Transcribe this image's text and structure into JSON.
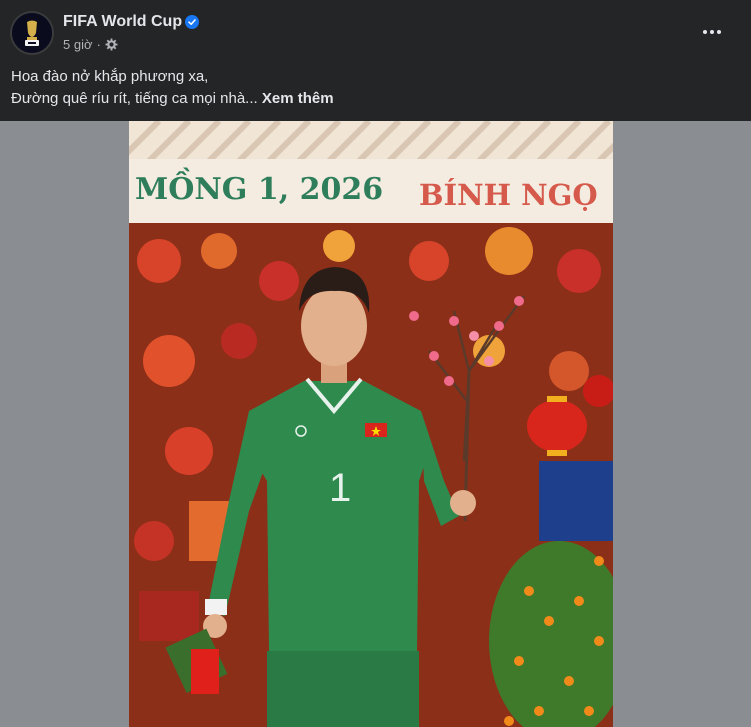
{
  "post": {
    "page_name": "FIFA World Cup",
    "time": "5 giờ",
    "separator": "·",
    "caption_line1": "Hoa đào nở khắp phương xa,",
    "caption_line2": "Đường quê ríu rít, tiếng ca mọi nhà...",
    "see_more": "Xem thêm"
  },
  "photo": {
    "banner_left": "MỒNG 1, 2026",
    "banner_right": "BÍNH NGỌ",
    "jersey_number": "1"
  },
  "icons": {
    "verified": "verified-badge-icon",
    "audience": "globe-gear-icon",
    "more": "more-options-icon"
  },
  "colors": {
    "background": "#242526",
    "text_primary": "#e4e6eb",
    "text_secondary": "#b0b3b8",
    "verified_blue": "#1877f2",
    "banner_green": "#2e7d5b",
    "banner_red": "#d65a4b",
    "jersey_green": "#2f8a4e"
  }
}
